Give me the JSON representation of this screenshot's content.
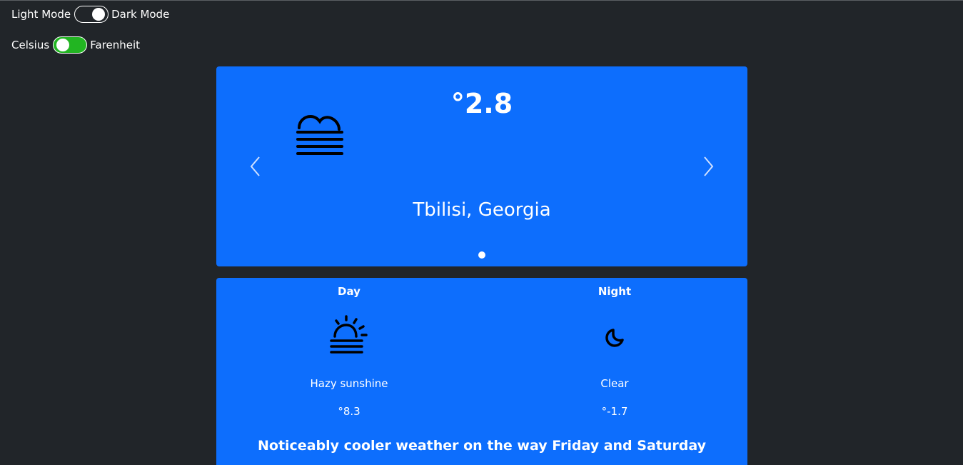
{
  "settings": {
    "mode_left_label": "Light Mode",
    "mode_right_label": "Dark Mode",
    "unit_left_label": "Celsius",
    "unit_right_label": "Farenheit"
  },
  "current": {
    "temperature": "°2.8",
    "location": "Tbilisi, Georgia",
    "icon": "fog-icon"
  },
  "forecast": {
    "day": {
      "heading": "Day",
      "icon": "hazy-sun-icon",
      "description": "Hazy sunshine",
      "temperature": "°8.3"
    },
    "night": {
      "heading": "Night",
      "icon": "clear-night-moon-icon",
      "description": "Clear",
      "temperature": "°-1.7"
    },
    "headline": "Noticeably cooler weather on the way Friday and Saturday"
  },
  "colors": {
    "background": "#212529",
    "card": "#0d6efd",
    "toggle_on": "#22b522"
  }
}
